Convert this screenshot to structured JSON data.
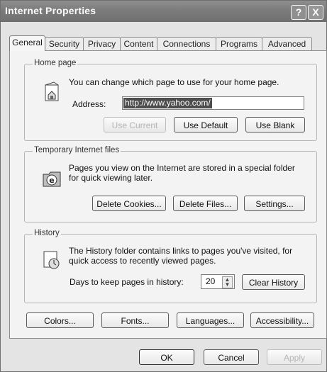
{
  "window": {
    "title": "Internet Properties",
    "help_label": "?",
    "close_label": "X"
  },
  "tabs": [
    "General",
    "Security",
    "Privacy",
    "Content",
    "Connections",
    "Programs",
    "Advanced"
  ],
  "home_page": {
    "legend": "Home page",
    "description": "You can change which page to use for your home page.",
    "address_label": "Address:",
    "address_value": "http://www.yahoo.com/",
    "use_current": "Use Current",
    "use_default": "Use Default",
    "use_blank": "Use Blank"
  },
  "temp_files": {
    "legend": "Temporary Internet files",
    "description_line1": "Pages you view on the Internet are stored in a special folder",
    "description_line2": "for quick viewing later.",
    "delete_cookies": "Delete Cookies...",
    "delete_files": "Delete Files...",
    "settings": "Settings..."
  },
  "history": {
    "legend": "History",
    "description_line1": "The History folder contains links to pages you've visited, for",
    "description_line2": "quick access to recently viewed pages.",
    "days_label": "Days to keep pages in history:",
    "days_value": "20",
    "clear_history": "Clear History"
  },
  "bottom_buttons": {
    "colors": "Colors...",
    "fonts": "Fonts...",
    "languages": "Languages...",
    "accessibility": "Accessibility..."
  },
  "dialog_buttons": {
    "ok": "OK",
    "cancel": "Cancel",
    "apply": "Apply"
  }
}
